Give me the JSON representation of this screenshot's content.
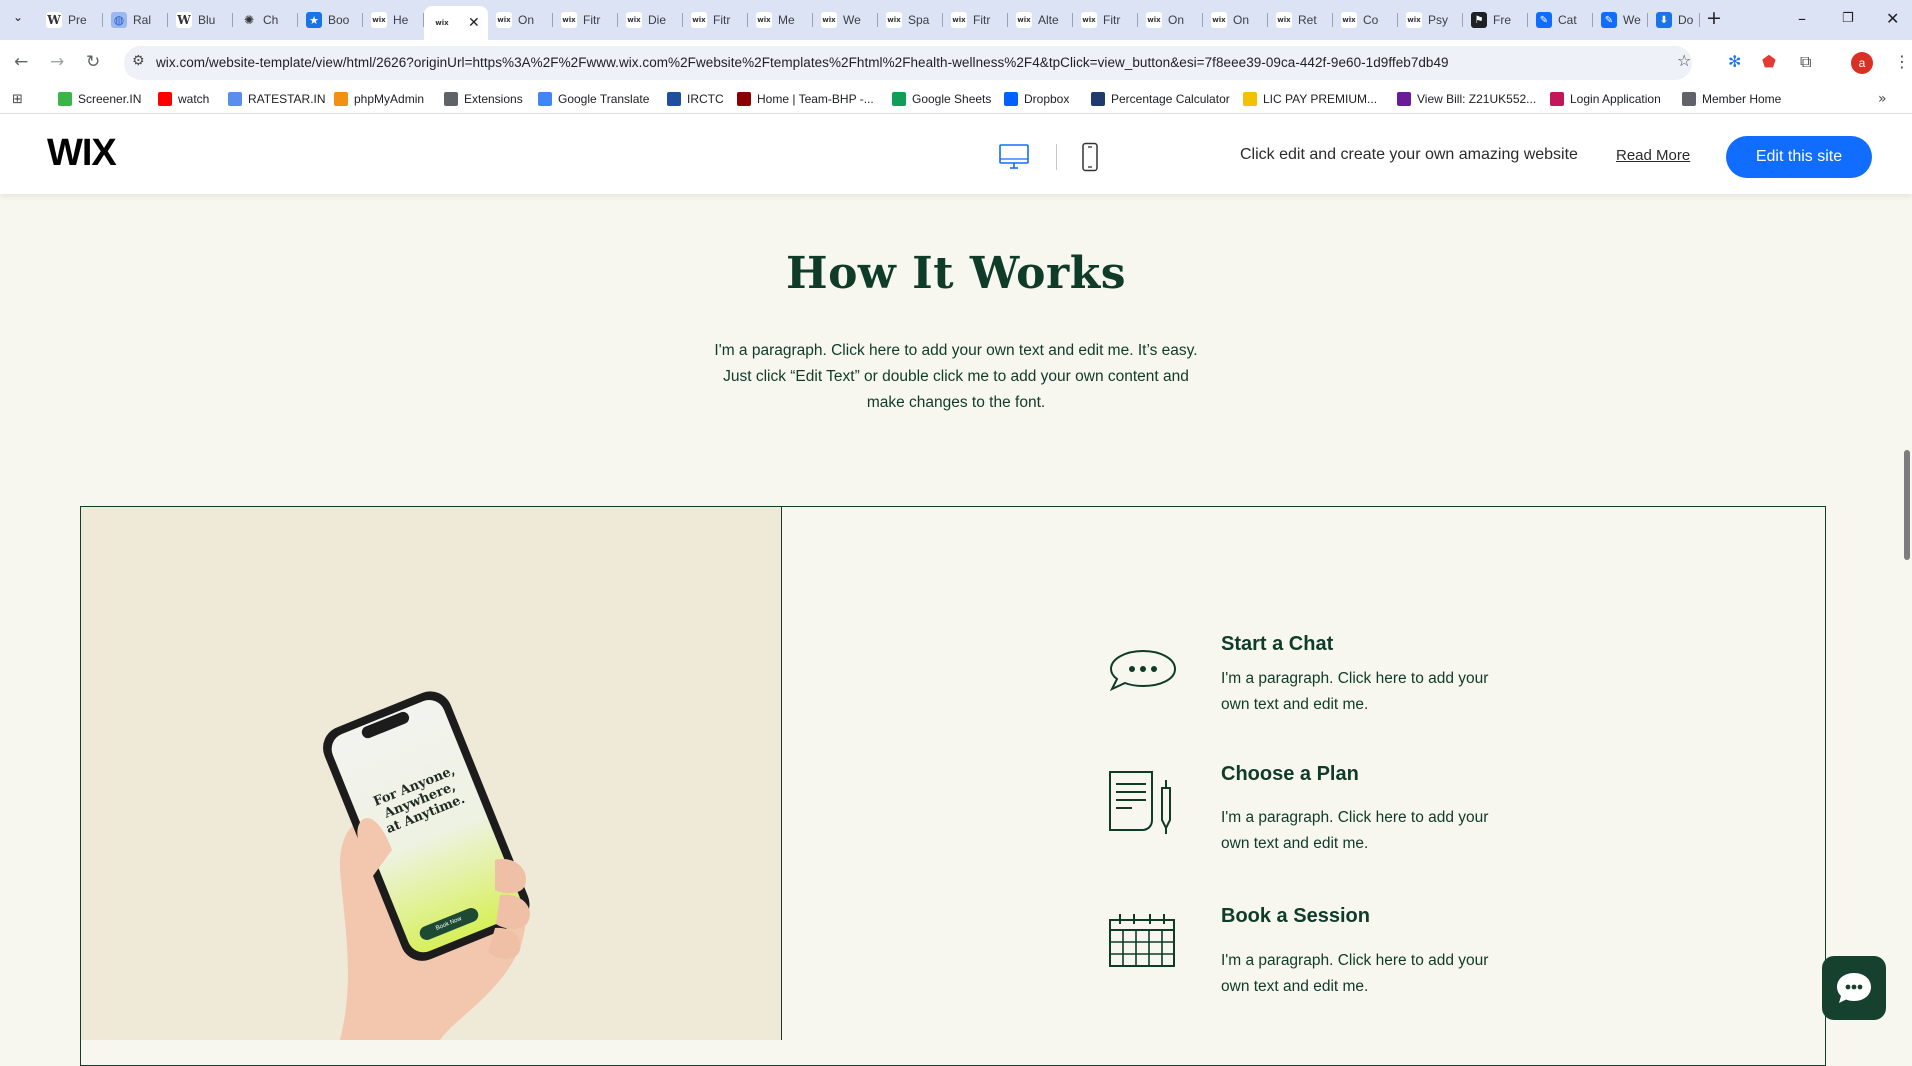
{
  "browser": {
    "tabs": [
      {
        "label": "Pre",
        "icon": "W",
        "color": "#ffffff"
      },
      {
        "label": "Ral",
        "icon": "globe",
        "color": "#9bb8f2"
      },
      {
        "label": "Blu",
        "icon": "W",
        "color": "#ffffff"
      },
      {
        "label": "Ch",
        "icon": "openai",
        "color": "#dbe3f4"
      },
      {
        "label": "Boo",
        "icon": "star",
        "color": "#1a73e8"
      },
      {
        "label": "He",
        "icon": "wix",
        "color": "#ffffff"
      },
      {
        "label": "",
        "icon": "wix",
        "color": "#ffffff",
        "active": true
      },
      {
        "label": "On",
        "icon": "wix",
        "color": "#ffffff"
      },
      {
        "label": "Fitr",
        "icon": "wix",
        "color": "#ffffff"
      },
      {
        "label": "Die",
        "icon": "wix",
        "color": "#ffffff"
      },
      {
        "label": "Fitr",
        "icon": "wix",
        "color": "#ffffff"
      },
      {
        "label": "Me",
        "icon": "wix",
        "color": "#ffffff"
      },
      {
        "label": "We",
        "icon": "wix",
        "color": "#ffffff"
      },
      {
        "label": "Spa",
        "icon": "wix",
        "color": "#ffffff"
      },
      {
        "label": "Fitr",
        "icon": "wix",
        "color": "#ffffff"
      },
      {
        "label": "Alte",
        "icon": "wix",
        "color": "#ffffff"
      },
      {
        "label": "Fitr",
        "icon": "wix",
        "color": "#ffffff"
      },
      {
        "label": "On",
        "icon": "wix",
        "color": "#ffffff"
      },
      {
        "label": "On",
        "icon": "wix",
        "color": "#ffffff"
      },
      {
        "label": "Ret",
        "icon": "wix",
        "color": "#ffffff"
      },
      {
        "label": "Co",
        "icon": "wix",
        "color": "#ffffff"
      },
      {
        "label": "Psy",
        "icon": "wix",
        "color": "#ffffff"
      },
      {
        "label": "Fre",
        "icon": "flag",
        "color": "#202124"
      },
      {
        "label": "Cat",
        "icon": "editor",
        "color": "#116dff"
      },
      {
        "label": "We",
        "icon": "editor",
        "color": "#116dff"
      },
      {
        "label": "Do",
        "icon": "download",
        "color": "#1a73e8"
      }
    ],
    "url": "wix.com/website-template/view/html/2626?originUrl=https%3A%2F%2Fwww.wix.com%2Fwebsite%2Ftemplates%2Fhtml%2Fhealth-wellness%2F4&tpClick=view_button&esi=7f8eee39-09ca-442f-9e60-1d9ffeb7db49",
    "profile_initial": "a",
    "bookmarks": [
      {
        "label": "Screener.IN",
        "color": "#3bb54a"
      },
      {
        "label": "watch",
        "color": "#ff0000"
      },
      {
        "label": "RATESTAR.IN",
        "color": "#5b8def"
      },
      {
        "label": "phpMyAdmin",
        "color": "#f29111"
      },
      {
        "label": "Extensions",
        "color": "#5f6368"
      },
      {
        "label": "Google Translate",
        "color": "#4285f4"
      },
      {
        "label": "IRCTC",
        "color": "#1d4e9f"
      },
      {
        "label": "Home | Team-BHP -...",
        "color": "#8b0000"
      },
      {
        "label": "Google Sheets",
        "color": "#0f9d58"
      },
      {
        "label": "Dropbox",
        "color": "#0061fe"
      },
      {
        "label": "Percentage Calculator",
        "color": "#1f3b6e"
      },
      {
        "label": "LIC PAY PREMIUM...",
        "color": "#f2c200"
      },
      {
        "label": "View Bill: Z21UK552...",
        "color": "#6a1b9a"
      },
      {
        "label": "Login Application",
        "color": "#c2185b"
      },
      {
        "label": "Member Home",
        "color": "#5f6368"
      }
    ]
  },
  "wix": {
    "logo": "WIX",
    "promo_text": "Click edit and create your own amazing website",
    "read_more": "Read More",
    "edit_button": "Edit this site"
  },
  "page": {
    "title": "How It Works",
    "intro_lines": [
      "I'm a paragraph. Click here to add your own text and edit me. It’s easy.",
      "Just click “Edit Text” or double click me to add your own content and",
      "make changes to the font."
    ],
    "phone_text": [
      "For Anyone,",
      "Anywhere,",
      "at Anytime."
    ],
    "phone_button": "Book Now",
    "steps": [
      {
        "title": "Start a Chat",
        "icon": "chat-bubble-icon",
        "lines": [
          "I'm a paragraph. Click here to add your",
          "own text and edit me."
        ]
      },
      {
        "title": "Choose a Plan",
        "icon": "document-pen-icon",
        "lines": [
          "I'm a paragraph. Click here to add your",
          "own text and edit me."
        ]
      },
      {
        "title": "Book a Session",
        "icon": "calendar-icon",
        "lines": [
          "I'm a paragraph. Click here to add your",
          "own text and edit me."
        ]
      }
    ]
  },
  "colors": {
    "brand_green": "#0f3b29",
    "edit_blue": "#116dff",
    "page_bg": "#f7f6ef",
    "panel_bg": "#efe9d7"
  }
}
